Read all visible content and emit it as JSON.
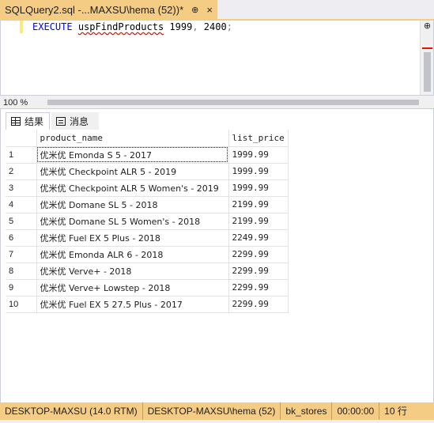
{
  "document_tab": {
    "title": "SQLQuery2.sql -...MAXSU\\hema (52))*",
    "pin_glyph": "⊕",
    "close_glyph": "×"
  },
  "editor": {
    "keyword": "EXECUTE",
    "procedure": "uspFindProducts",
    "arg1": "1999",
    "comma": ",",
    "arg2": "2400",
    "terminator": ";"
  },
  "zoom": {
    "value": "100 %"
  },
  "results_tabs": [
    {
      "label": "结果",
      "icon": "grid-icon",
      "active": true
    },
    {
      "label": "消息",
      "icon": "messages-icon",
      "active": false
    }
  ],
  "grid": {
    "columns": [
      "product_name",
      "list_price"
    ],
    "rows": [
      {
        "n": "1",
        "name": "优米优 Emonda S 5 - 2017",
        "price": "1999.99"
      },
      {
        "n": "2",
        "name": "优米优 Checkpoint ALR 5 - 2019",
        "price": "1999.99"
      },
      {
        "n": "3",
        "name": "优米优 Checkpoint ALR 5 Women's - 2019",
        "price": "1999.99"
      },
      {
        "n": "4",
        "name": "优米优 Domane SL 5 - 2018",
        "price": "2199.99"
      },
      {
        "n": "5",
        "name": "优米优 Domane SL 5 Women's - 2018",
        "price": "2199.99"
      },
      {
        "n": "6",
        "name": "优米优 Fuel EX 5 Plus - 2018",
        "price": "2249.99"
      },
      {
        "n": "7",
        "name": "优米优 Emonda ALR 6 - 2018",
        "price": "2299.99"
      },
      {
        "n": "8",
        "name": "优米优 Verve+ - 2018",
        "price": "2299.99"
      },
      {
        "n": "9",
        "name": "优米优 Verve+ Lowstep - 2018",
        "price": "2299.99"
      },
      {
        "n": "10",
        "name": "优米优 Fuel EX 5 27.5 Plus - 2017",
        "price": "2299.99"
      }
    ]
  },
  "status_bar": {
    "server": "DESKTOP-MAXSU (14.0 RTM)",
    "user": "DESKTOP-MAXSU\\hema (52)",
    "database": "bk_stores",
    "elapsed": "00:00:00",
    "row_count": "10 行"
  },
  "colors": {
    "accent": "#f5cc84",
    "keyword": "#0000ff",
    "error_squiggle": "#e51400"
  }
}
